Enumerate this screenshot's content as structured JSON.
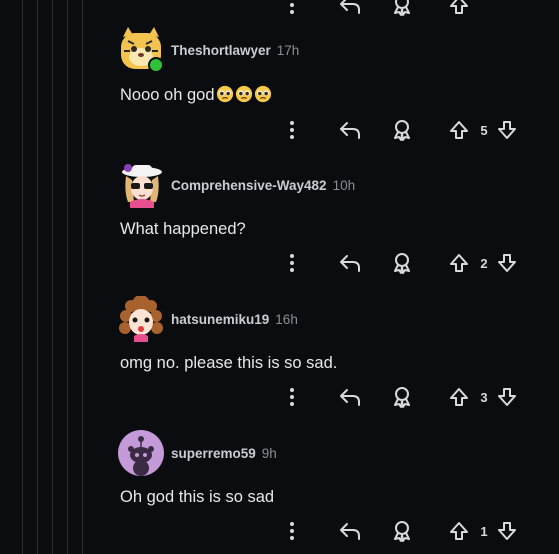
{
  "colors": {
    "background": "#0b0c0f",
    "thread_line": "#2a2d31",
    "online": "#2ec13a",
    "text": "#e6e8ea",
    "muted": "#8a8f94"
  },
  "comments": [
    {
      "username": "Theshortlawyer",
      "time": "17h",
      "body": "Nooo oh god",
      "emojis": [
        "pleading-face",
        "pleading-face",
        "pleading-face"
      ],
      "online": true,
      "avatar": "tiger-avatar",
      "votes": "5"
    },
    {
      "username": "Comprehensive-Way482",
      "time": "10h",
      "body": "What happened?",
      "avatar": "sunhat-avatar",
      "votes": "2"
    },
    {
      "username": "hatsunemiku19",
      "time": "16h",
      "body": "omg no. please this is so sad.",
      "avatar": "curly-hair-avatar",
      "votes": "3"
    },
    {
      "username": "superremo59",
      "time": "9h",
      "body": "Oh god this is so sad",
      "avatar": "default-snoo-avatar",
      "votes": "1"
    }
  ],
  "icons": {
    "more": "more-vertical-icon",
    "reply": "reply-icon",
    "award": "award-icon",
    "upvote": "upvote-icon",
    "downvote": "downvote-icon"
  }
}
